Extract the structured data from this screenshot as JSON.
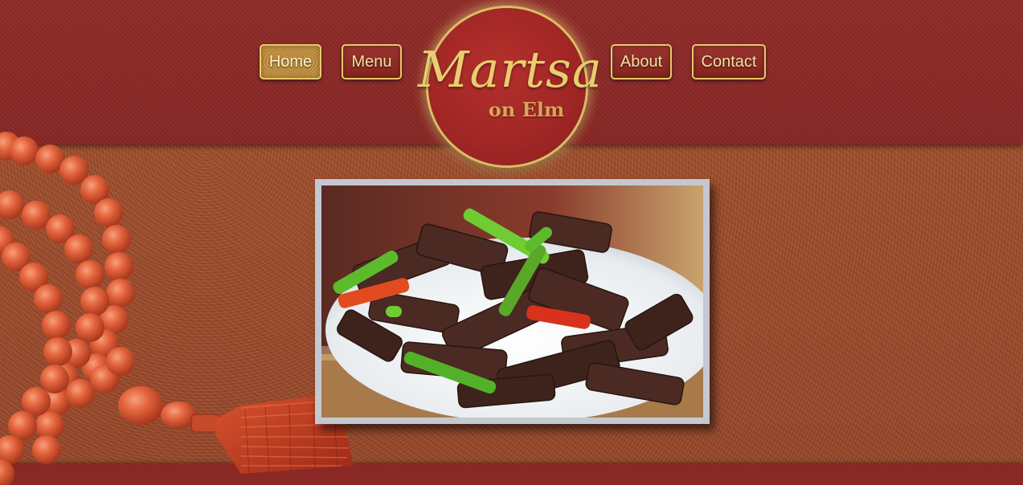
{
  "logo": {
    "name": "Martsa",
    "subtitle": "on Elm"
  },
  "nav": {
    "home": "Home",
    "menu": "Menu",
    "about": "About",
    "contact": "Contact",
    "active": "Home"
  },
  "colors": {
    "header_red": "#8e2a27",
    "body_rust": "#9a4a2e",
    "gold": "#e8c96a",
    "frame_gray": "#c4c8d0",
    "bead_coral": "#e0613a"
  },
  "images": {
    "hero": "beef-with-peppers-dish-photo",
    "decoration": "coral-prayer-beads-with-tassel"
  }
}
